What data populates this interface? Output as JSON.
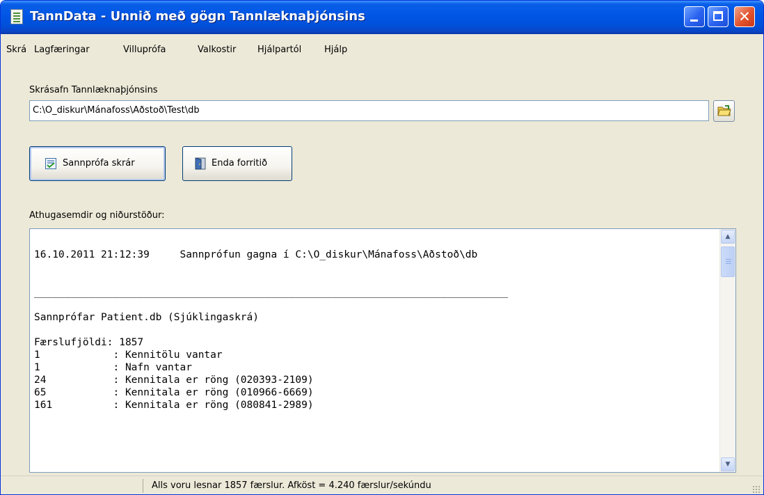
{
  "window": {
    "title": "TannData - Unnið með gögn Tannlæknaþjónsins",
    "controls": {
      "minimize": "",
      "maximize": "",
      "close": "✕"
    }
  },
  "menu": {
    "items": [
      "Skrá",
      "Lagfæringar",
      "Villuprófa",
      "Valkostir",
      "Hjálpartól",
      "Hjálp"
    ]
  },
  "folder": {
    "label": "Skrásafn Tannlæknaþjónsins",
    "path": "C:\\O_diskur\\Mánafoss\\Aðstoð\\Test\\db"
  },
  "buttons": {
    "verify": "Sannprófa skrár",
    "end": "Enda forritið"
  },
  "results": {
    "label": "Athugasemdir og niðurstöður:",
    "lines": [
      "16.10.2011 21:12:39     Sannprófun gagna í C:\\O_diskur\\Mánafoss\\Aðstoð\\db",
      "",
      "",
      "______________________________________________________________________________",
      "",
      "Sannprófar Patient.db (Sjúklingaskrá)",
      "",
      "Færslufjöldi: 1857",
      "1            : Kennitölu vantar",
      "1            : Nafn vantar",
      "24           : Kennitala er röng (020393-2109)",
      "65           : Kennitala er röng (010966-6669)",
      "161          : Kennitala er röng (080841-2989)"
    ]
  },
  "status": {
    "text": "Alls voru lesnar 1857 færslur.  Afköst = 4.240 færslur/sekúndu"
  }
}
